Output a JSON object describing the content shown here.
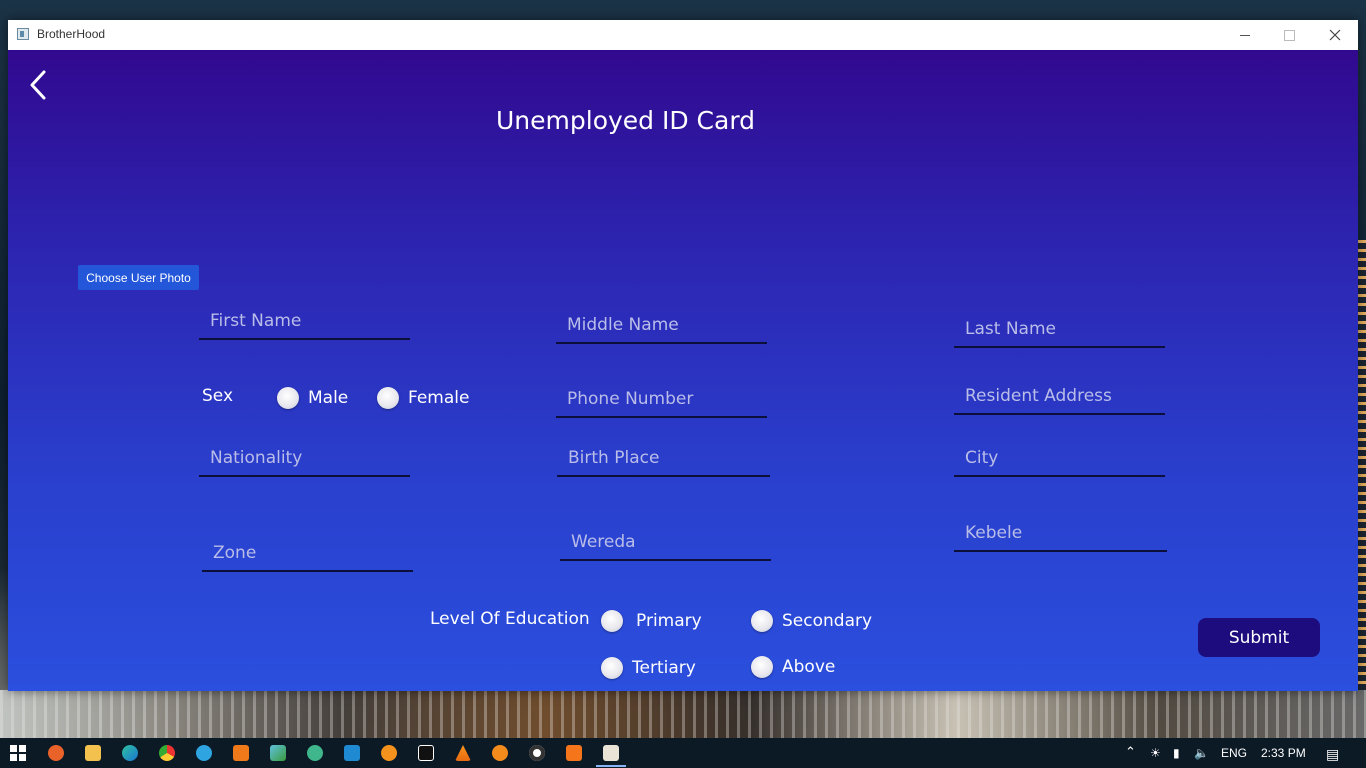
{
  "window": {
    "title": "BrotherHood"
  },
  "page": {
    "title": "Unemployed ID Card",
    "choose_photo_label": "Choose User  Photo",
    "submit_label": "Submit"
  },
  "fields": {
    "first_name": "First Name",
    "middle_name": "Middle Name",
    "last_name": "Last Name",
    "phone_number": "Phone Number",
    "resident_address": "Resident Address",
    "nationality": "Nationality",
    "birth_place": "Birth Place",
    "city": "City",
    "zone": "Zone",
    "wereda": "Wereda",
    "kebele": "Kebele"
  },
  "sex": {
    "label": "Sex",
    "options": [
      "Male",
      "Female"
    ],
    "selected": null
  },
  "education": {
    "label": "Level Of Education",
    "options": [
      "Primary",
      "Secondary",
      "Tertiary",
      "Above"
    ],
    "selected": null
  },
  "taskbar": {
    "language": "ENG",
    "time": "2:33 PM",
    "apps": [
      "start-icon",
      "ccleaner-icon",
      "file-explorer-icon",
      "edge-icon",
      "chrome-icon",
      "telegram-icon",
      "sublime-icon",
      "app-icon",
      "sourcetree-icon",
      "vscode-icon",
      "firefox-icon",
      "intellij-icon",
      "vlc-icon",
      "search-app-icon",
      "obs-icon",
      "xampp-icon",
      "java-icon"
    ]
  },
  "colors": {
    "accent_button": "#2356d8",
    "submit_button": "#1d0c7e",
    "gradient_top": "#31098f",
    "gradient_bottom": "#2b4fde"
  }
}
